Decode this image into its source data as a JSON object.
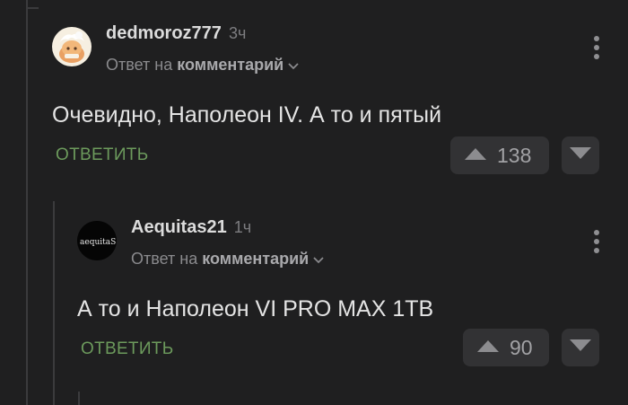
{
  "comments": [
    {
      "username": "dedmoroz777",
      "time": "3ч",
      "reply_prefix": "Ответ на",
      "reply_link": "комментарий",
      "text": "Очевидно, Наполеон IV. А то и пятый",
      "reply_label": "ОТВЕТИТЬ",
      "rating": "138"
    },
    {
      "username": "Aequitas21",
      "time": "1ч",
      "reply_prefix": "Ответ на",
      "reply_link": "комментарий",
      "text": "А то и Наполеон VI PRO MAX 1TB",
      "reply_label": "ОТВЕТИТЬ",
      "rating": "90",
      "avatar_text": "aequitaS"
    }
  ],
  "icons": [
    "avatar",
    "chevron-down-icon",
    "more-vertical-icon",
    "arrow-up-icon",
    "arrow-down-icon"
  ],
  "colors": {
    "background": "#1f1f20",
    "reply_green": "#6c9a5c",
    "vote_bg": "#323234"
  }
}
